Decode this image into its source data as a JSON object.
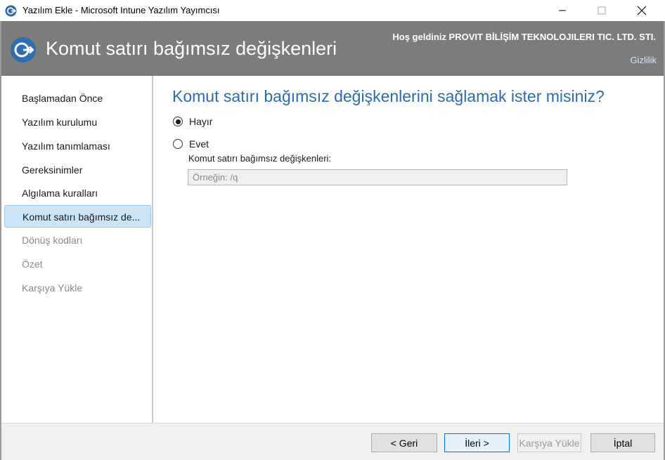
{
  "window": {
    "title": "Yazılım Ekle - Microsoft Intune Yazılım Yayımcısı"
  },
  "header": {
    "title": "Komut satırı bağımsız değişkenleri",
    "welcome": "Hoş geldiniz PROVIT BİLİŞİM TEKNOLOJILERI TIC. LTD. STI.",
    "privacy_link": "Gizlilik"
  },
  "sidebar": {
    "items": [
      {
        "label": "Başlamadan Önce",
        "state": "normal"
      },
      {
        "label": "Yazılım kurulumu",
        "state": "normal"
      },
      {
        "label": "Yazılım tanımlaması",
        "state": "normal"
      },
      {
        "label": "Gereksinimler",
        "state": "normal"
      },
      {
        "label": "Algılama kuralları",
        "state": "normal"
      },
      {
        "label": "Komut satırı bağımsız de...",
        "state": "selected"
      },
      {
        "label": "Dönüş kodları",
        "state": "disabled"
      },
      {
        "label": "Özet",
        "state": "disabled"
      },
      {
        "label": "Karşıya Yükle",
        "state": "disabled"
      }
    ]
  },
  "main": {
    "question": "Komut satırı bağımsız değişkenlerini sağlamak ister misiniz?",
    "options": [
      {
        "label": "Hayır",
        "selected": true
      },
      {
        "label": "Evet",
        "selected": false
      }
    ],
    "field_label": "Komut satırı bağımsız değişkenleri:",
    "field_value": "",
    "field_placeholder": "Örneğin: /q"
  },
  "footer": {
    "back_label": "< Geri",
    "next_label": "İleri >",
    "upload_label": "Karşıya Yükle",
    "cancel_label": "İptal"
  },
  "colors": {
    "header_bg": "#7c7c7c",
    "accent_text": "#2a6bb5",
    "selected_bg": "#cce4f7"
  }
}
